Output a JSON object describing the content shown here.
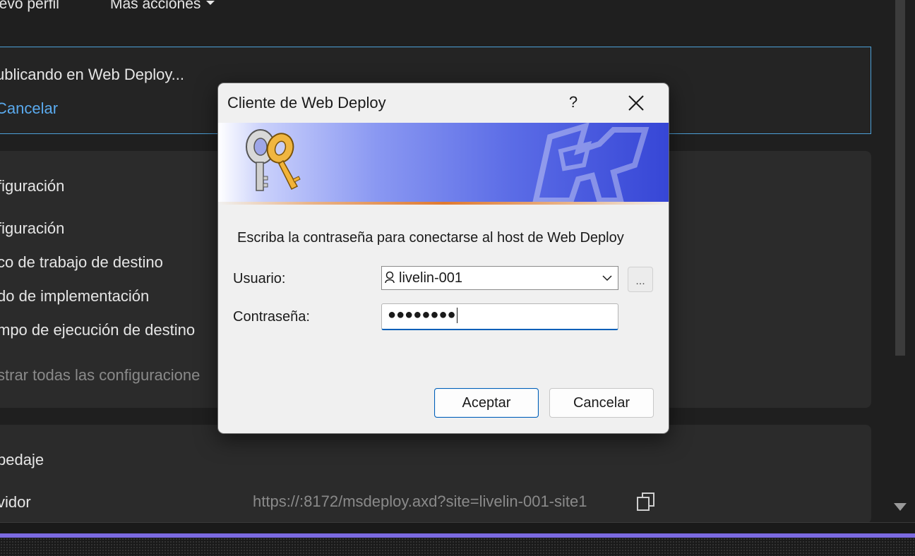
{
  "toolbar": {
    "new_profile": "ievo perfil",
    "more_actions": "Más acciones"
  },
  "publish": {
    "status": "ublicando en Web Deploy...",
    "cancel": "Cancelar"
  },
  "settings": {
    "header": "figuración",
    "items": [
      "figuración",
      "co de trabajo de destino",
      "do de implementación",
      "mpo de ejecución de destino"
    ],
    "show_all": "strar todas las configuracione"
  },
  "hosting": {
    "header": "pedaje",
    "server_label": "vidor",
    "server_url": "https://:8172/msdeploy.axd?site=livelin-001-site1"
  },
  "dialog": {
    "title": "Cliente de Web Deploy",
    "help": "?",
    "message": "Escriba la contraseña para conectarse al host de Web Deploy",
    "user_label": "Usuario:",
    "user_value": "livelin-001",
    "browse": "...",
    "password_label": "Contraseña:",
    "password_value": "●●●●●●●●",
    "ok": "Aceptar",
    "cancel": "Cancelar"
  },
  "icons": {
    "close": "close-icon",
    "keys": "keys-icon",
    "copy": "copy-icon",
    "user": "user-icon",
    "dropdown": "chevron-down-icon"
  },
  "colors": {
    "accent": "#005fb8",
    "link": "#5aaaee",
    "status_bar": "#7b6ae0"
  }
}
